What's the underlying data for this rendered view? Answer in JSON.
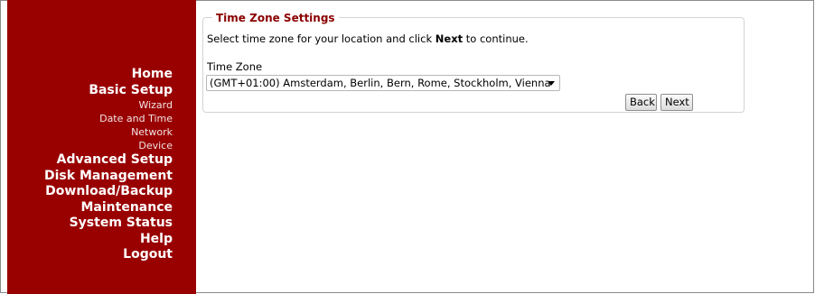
{
  "sidebar": {
    "items": [
      {
        "label": "Home",
        "level": "main"
      },
      {
        "label": "Basic Setup",
        "level": "main"
      },
      {
        "label": "Wizard",
        "level": "sub"
      },
      {
        "label": "Date and Time",
        "level": "sub"
      },
      {
        "label": "Network",
        "level": "sub"
      },
      {
        "label": "Device",
        "level": "sub"
      },
      {
        "label": "Advanced Setup",
        "level": "main"
      },
      {
        "label": "Disk Management",
        "level": "main"
      },
      {
        "label": "Download/Backup",
        "level": "main"
      },
      {
        "label": "Maintenance",
        "level": "main"
      },
      {
        "label": "System Status",
        "level": "main"
      },
      {
        "label": "Help",
        "level": "main"
      },
      {
        "label": "Logout",
        "level": "main"
      }
    ]
  },
  "panel": {
    "legend": "Time Zone Settings",
    "instruction_prefix": "Select time zone for your location and click ",
    "instruction_emphasis": "Next",
    "instruction_suffix": " to continue.",
    "timezone_label": "Time Zone",
    "timezone_selected": "(GMT+01:00) Amsterdam, Berlin, Bern, Rome, Stockholm, Vienna"
  },
  "buttons": {
    "back": "Back",
    "next": "Next"
  },
  "colors": {
    "sidebar_bg": "#990000",
    "legend_text": "#8b0000"
  }
}
